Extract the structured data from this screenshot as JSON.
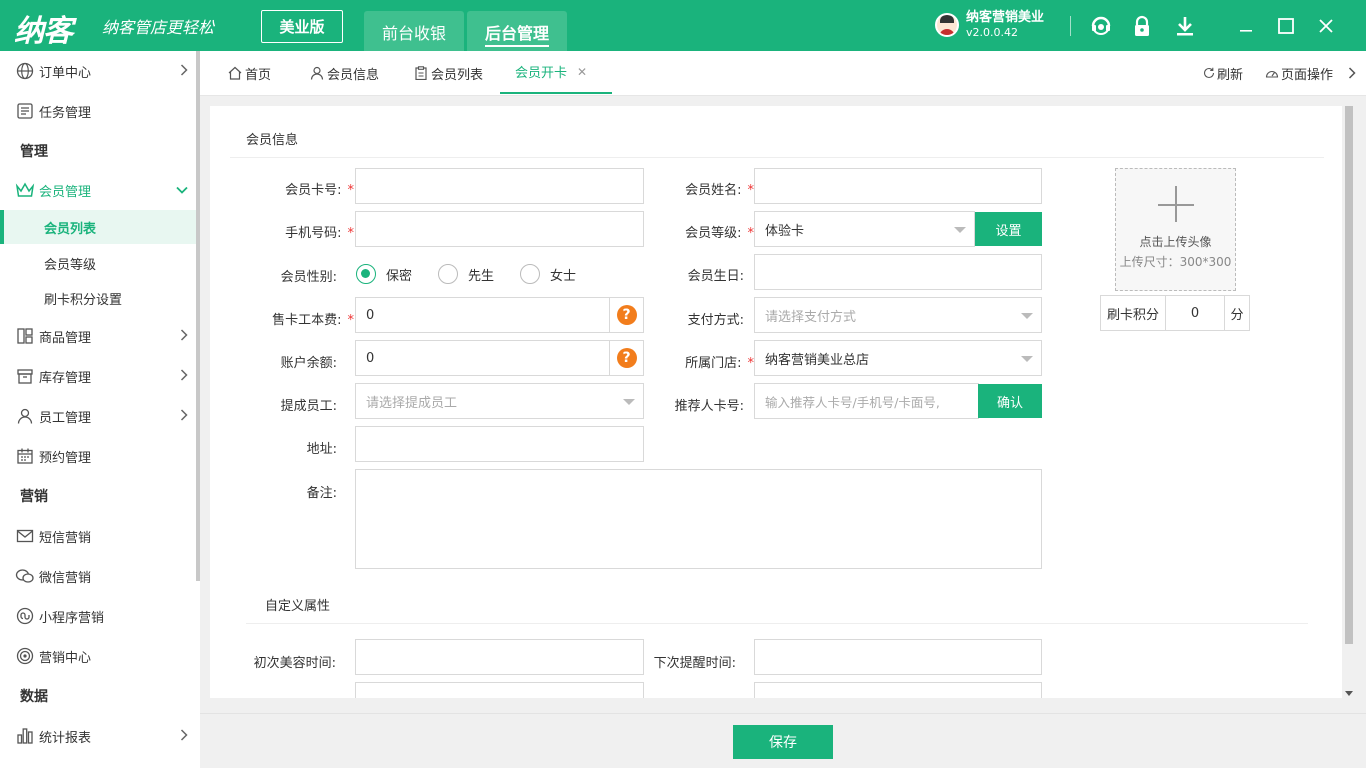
{
  "app": {
    "logo": "纳客",
    "slogan": "纳客管店更轻松",
    "edition": "美业版",
    "nav_tabs": [
      "前台收银",
      "后台管理"
    ],
    "user_name": "纳客营销美业",
    "version": "v2.0.0.42",
    "brand_color": "#1ab37c"
  },
  "sidebar": {
    "order_center": "订单中心",
    "task_mgmt": "任务管理",
    "section_manage": "管理",
    "member_mgmt": "会员管理",
    "member_list": "会员列表",
    "member_level": "会员等级",
    "card_points": "刷卡积分设置",
    "goods_mgmt": "商品管理",
    "stock_mgmt": "库存管理",
    "staff_mgmt": "员工管理",
    "booking_mgmt": "预约管理",
    "section_marketing": "营销",
    "sms_marketing": "短信营销",
    "wechat_marketing": "微信营销",
    "miniapp_marketing": "小程序营销",
    "marketing_center": "营销中心",
    "section_data": "数据",
    "stats_report": "统计报表"
  },
  "tabs": {
    "home": "首页",
    "member_info": "会员信息",
    "member_list": "会员列表",
    "open_card": "会员开卡",
    "refresh": "刷新",
    "page_ops": "页面操作"
  },
  "form": {
    "section_title": "会员信息",
    "card_no_label": "会员卡号:",
    "name_label": "会员姓名:",
    "phone_label": "手机号码:",
    "level_label": "会员等级:",
    "level_value": "体验卡",
    "level_set_btn": "设置",
    "gender_label": "会员性别:",
    "gender_options": [
      "保密",
      "先生",
      "女士"
    ],
    "birthday_label": "会员生日:",
    "card_cost_label": "售卡工本费:",
    "card_cost_value": "0",
    "payment_label": "支付方式:",
    "payment_placeholder": "请选择支付方式",
    "balance_label": "账户余额:",
    "balance_value": "0",
    "store_label": "所属门店:",
    "store_value": "纳客营销美业总店",
    "commission_label": "提成员工:",
    "commission_placeholder": "请选择提成员工",
    "referrer_label": "推荐人卡号:",
    "referrer_placeholder": "输入推荐人卡号/手机号/卡面号,",
    "referrer_confirm": "确认",
    "address_label": "地址:",
    "remark_label": "备注:",
    "upload_text": "点击上传头像",
    "upload_size": "上传尺寸：300*300",
    "points_label": "刷卡积分",
    "points_value": "0",
    "points_unit": "分",
    "custom_section": "自定义属性",
    "first_beauty_label": "初次美容时间:",
    "next_remind_label": "下次提醒时间:",
    "save": "保存"
  }
}
